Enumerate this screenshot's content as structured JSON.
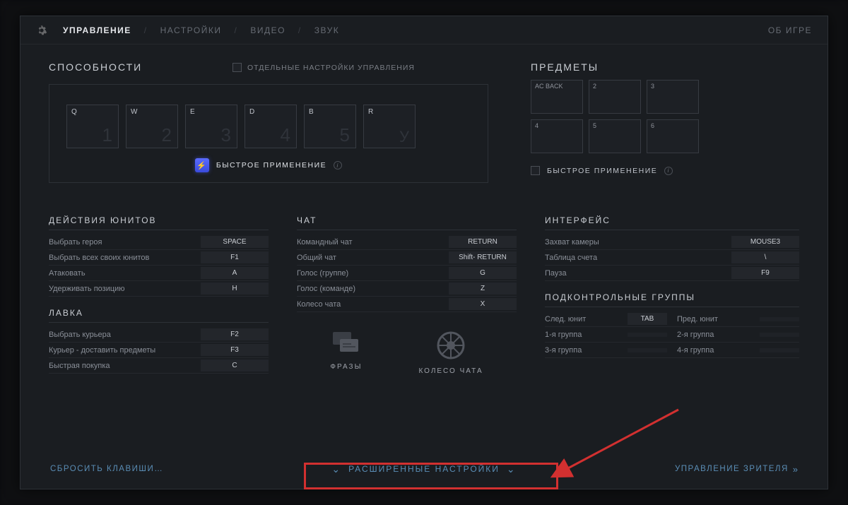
{
  "nav": {
    "items": [
      "УПРАВЛЕНИЕ",
      "НАСТРОЙКИ",
      "ВИДЕО",
      "ЗВУК"
    ],
    "right": "ОБ ИГРЕ"
  },
  "abilities": {
    "title": "СПОСОБНОСТИ",
    "separate_label": "ОТДЕЛЬНЫЕ НАСТРОЙКИ УПРАВЛЕНИЯ",
    "slots": [
      {
        "key": "Q",
        "num": "1"
      },
      {
        "key": "W",
        "num": "2"
      },
      {
        "key": "E",
        "num": "3"
      },
      {
        "key": "D",
        "num": "4"
      },
      {
        "key": "B",
        "num": "5"
      },
      {
        "key": "R",
        "num": "У"
      }
    ],
    "quickcast": "БЫСТРОЕ ПРИМЕНЕНИЕ"
  },
  "items": {
    "title": "ПРЕДМЕТЫ",
    "slots": [
      "AC BACK",
      "2",
      "3",
      "4",
      "5",
      "6"
    ],
    "quickcast": "БЫСТРОЕ ПРИМЕНЕНИЕ"
  },
  "unit_actions": {
    "title": "ДЕЙСТВИЯ ЮНИТОВ",
    "rows": [
      {
        "label": "Выбрать героя",
        "key": "SPACE"
      },
      {
        "label": "Выбрать всех своих юнитов",
        "key": "F1"
      },
      {
        "label": "Атаковать",
        "key": "A"
      },
      {
        "label": "Удерживать позицию",
        "key": "H"
      }
    ]
  },
  "shop": {
    "title": "ЛАВКА",
    "rows": [
      {
        "label": "Выбрать курьера",
        "key": "F2"
      },
      {
        "label": "Курьер - доставить предметы",
        "key": "F3"
      },
      {
        "label": "Быстрая покупка",
        "key": "C"
      }
    ]
  },
  "chat": {
    "title": "ЧАТ",
    "rows": [
      {
        "label": "Командный чат",
        "key": "RETURN"
      },
      {
        "label": "Общий чат",
        "key": "Shift- RETURN"
      },
      {
        "label": "Голос (группе)",
        "key": "G"
      },
      {
        "label": "Голос (команде)",
        "key": "Z"
      },
      {
        "label": "Колесо чата",
        "key": "X"
      }
    ],
    "extras": {
      "phrases": "ФРАЗЫ",
      "wheel": "КОЛЕСО ЧАТА"
    }
  },
  "interface": {
    "title": "ИНТЕРФЕЙС",
    "rows": [
      {
        "label": "Захват камеры",
        "key": "MOUSE3"
      },
      {
        "label": "Таблица счета",
        "key": "\\"
      },
      {
        "label": "Пауза",
        "key": "F9"
      }
    ]
  },
  "control_groups": {
    "title": "ПОДКОНТРОЛЬНЫЕ ГРУППЫ",
    "row0": {
      "l1": "След. юнит",
      "k1": "TAB",
      "l2": "Пред. юнит",
      "k2": ""
    },
    "rows": [
      {
        "l1": "1-я группа",
        "l2": "2-я группа"
      },
      {
        "l1": "3-я группа",
        "l2": "4-я группа"
      }
    ]
  },
  "footer": {
    "reset": "СБРОСИТЬ КЛАВИШИ…",
    "advanced": "РАСШИРЕННЫЕ НАСТРОЙКИ",
    "spectator": "УПРАВЛЕНИЕ ЗРИТЕЛЯ"
  }
}
